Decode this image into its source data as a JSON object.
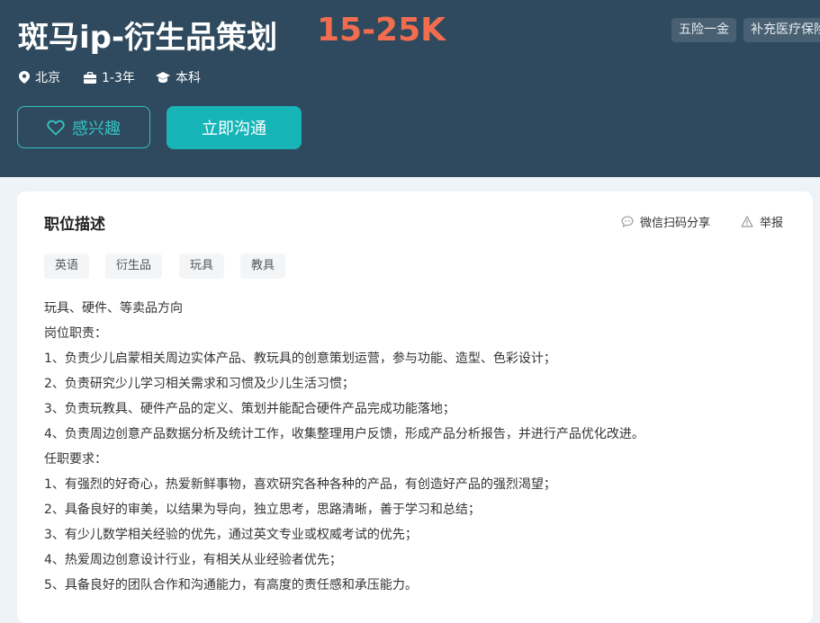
{
  "job": {
    "title": "斑马ip-衍生品策划",
    "salary": "15-25K",
    "benefits": [
      "五险一金",
      "补充医疗保险"
    ],
    "location": "北京",
    "experience": "1-3年",
    "education": "本科"
  },
  "actions": {
    "interest_label": "感兴趣",
    "chat_label": "立即沟通"
  },
  "description": {
    "title": "职位描述",
    "share_label": "微信扫码分享",
    "report_label": "举报",
    "tags": [
      "英语",
      "衍生品",
      "玩具",
      "教具"
    ],
    "lines": [
      "玩具、硬件、等卖品方向",
      "岗位职责：",
      "1、负责少儿启蒙相关周边实体产品、教玩具的创意策划运营，参与功能、造型、色彩设计；",
      "2、负责研究少儿学习相关需求和习惯及少儿生活习惯；",
      "3、负责玩教具、硬件产品的定义、策划并能配合硬件产品完成功能落地；",
      "4、负责周边创意产品数据分析及统计工作，收集整理用户反馈，形成产品分析报告，并进行产品优化改进。",
      "任职要求：",
      "1、有强烈的好奇心，热爱新鲜事物，喜欢研究各种各种的产品，有创造好产品的强烈渴望；",
      "2、具备良好的审美，以结果为导向，独立思考，思路清晰，善于学习和总结；",
      "3、有少儿数学相关经验的优先，通过英文专业或权威考试的优先；",
      "4、热爱周边创意设计行业，有相关从业经验者优先；",
      "5、具备良好的团队合作和沟通能力，有高度的责任感和承压能力。"
    ]
  },
  "colors": {
    "header_bg": "#2f4a5e",
    "salary": "#f26d4f",
    "accent": "#18b5b8"
  }
}
